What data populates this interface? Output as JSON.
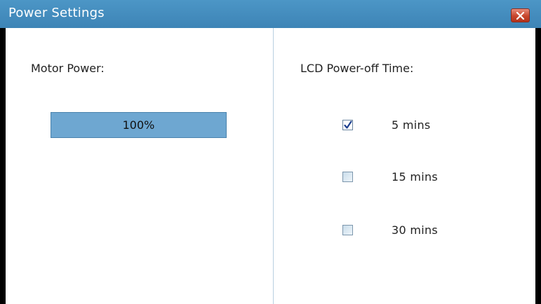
{
  "window": {
    "title": "Power Settings",
    "close_icon": "close-icon"
  },
  "motor": {
    "label": "Motor Power:",
    "value_text": "100%",
    "value_percent": 100,
    "fill_color": "#6ea7d1"
  },
  "lcd": {
    "label": "LCD Power-off Time:",
    "options": [
      {
        "label": "5 mins",
        "checked": true
      },
      {
        "label": "15 mins",
        "checked": false
      },
      {
        "label": "30 mins",
        "checked": false
      }
    ]
  },
  "colors": {
    "titlebar": "#4a92c3",
    "close_button": "#c7452c",
    "divider": "#b9d0e0"
  }
}
